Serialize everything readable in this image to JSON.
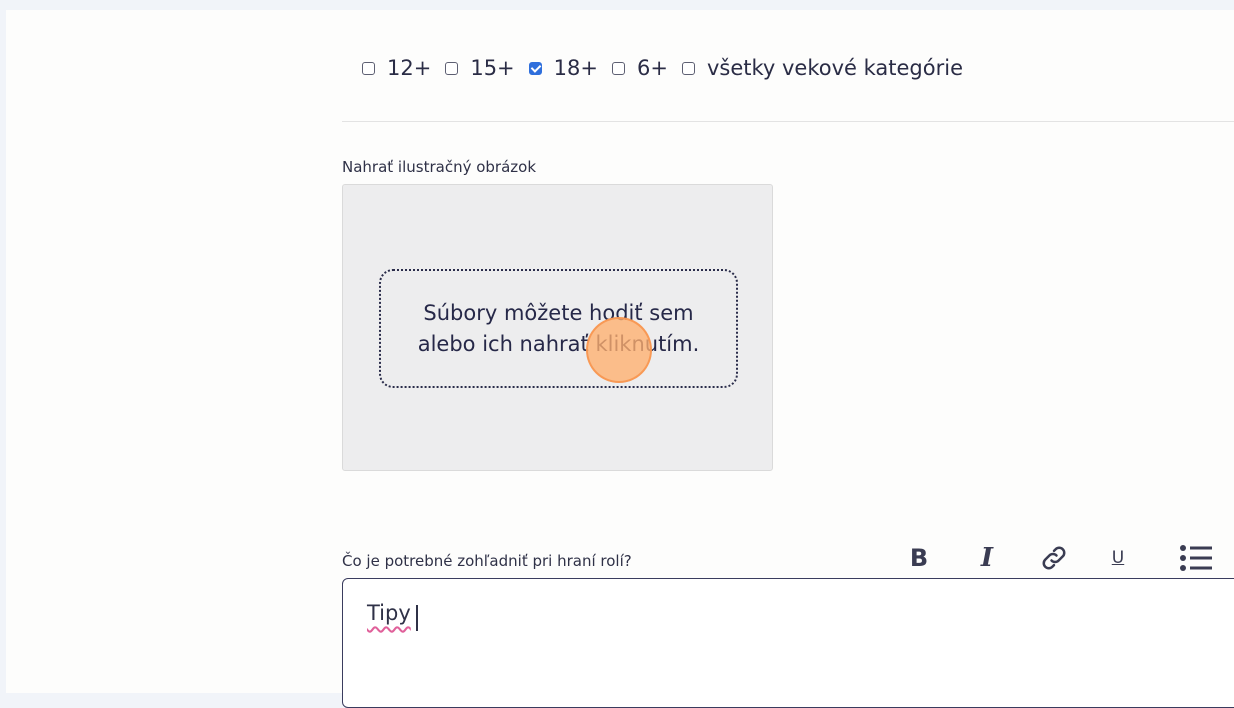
{
  "age_categories": {
    "options": [
      {
        "label": "12+",
        "checked": false
      },
      {
        "label": "15+",
        "checked": false
      },
      {
        "label": "18+",
        "checked": true
      },
      {
        "label": "6+",
        "checked": false
      },
      {
        "label": "všetky vekové kategórie",
        "checked": false
      }
    ]
  },
  "upload": {
    "label": "Nahrať ilustračný obrázok",
    "line1": "Súbory môžete hodiť sem",
    "line2": "alebo ich nahrať kliknutím."
  },
  "editor": {
    "label": "Čo je potrebné zohľadniť pri hraní rolí?",
    "value": "Tipy",
    "toolbar": {
      "bold": "B",
      "italic": "I",
      "underline": "U",
      "link_icon": "link-icon",
      "list_icon": "bulleted-list-icon"
    }
  },
  "colors": {
    "accent_checkbox": "#2f6fdc",
    "click_indicator": "#ffb06e",
    "spellcheck_underline": "#e0609a"
  }
}
